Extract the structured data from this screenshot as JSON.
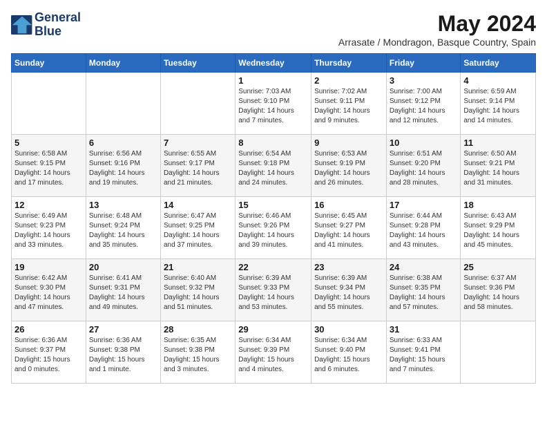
{
  "logo": {
    "line1": "General",
    "line2": "Blue"
  },
  "title": "May 2024",
  "subtitle": "Arrasate / Mondragon, Basque Country, Spain",
  "days_of_week": [
    "Sunday",
    "Monday",
    "Tuesday",
    "Wednesday",
    "Thursday",
    "Friday",
    "Saturday"
  ],
  "weeks": [
    [
      {
        "day": "",
        "info": ""
      },
      {
        "day": "",
        "info": ""
      },
      {
        "day": "",
        "info": ""
      },
      {
        "day": "1",
        "info": "Sunrise: 7:03 AM\nSunset: 9:10 PM\nDaylight: 14 hours\nand 7 minutes."
      },
      {
        "day": "2",
        "info": "Sunrise: 7:02 AM\nSunset: 9:11 PM\nDaylight: 14 hours\nand 9 minutes."
      },
      {
        "day": "3",
        "info": "Sunrise: 7:00 AM\nSunset: 9:12 PM\nDaylight: 14 hours\nand 12 minutes."
      },
      {
        "day": "4",
        "info": "Sunrise: 6:59 AM\nSunset: 9:14 PM\nDaylight: 14 hours\nand 14 minutes."
      }
    ],
    [
      {
        "day": "5",
        "info": "Sunrise: 6:58 AM\nSunset: 9:15 PM\nDaylight: 14 hours\nand 17 minutes."
      },
      {
        "day": "6",
        "info": "Sunrise: 6:56 AM\nSunset: 9:16 PM\nDaylight: 14 hours\nand 19 minutes."
      },
      {
        "day": "7",
        "info": "Sunrise: 6:55 AM\nSunset: 9:17 PM\nDaylight: 14 hours\nand 21 minutes."
      },
      {
        "day": "8",
        "info": "Sunrise: 6:54 AM\nSunset: 9:18 PM\nDaylight: 14 hours\nand 24 minutes."
      },
      {
        "day": "9",
        "info": "Sunrise: 6:53 AM\nSunset: 9:19 PM\nDaylight: 14 hours\nand 26 minutes."
      },
      {
        "day": "10",
        "info": "Sunrise: 6:51 AM\nSunset: 9:20 PM\nDaylight: 14 hours\nand 28 minutes."
      },
      {
        "day": "11",
        "info": "Sunrise: 6:50 AM\nSunset: 9:21 PM\nDaylight: 14 hours\nand 31 minutes."
      }
    ],
    [
      {
        "day": "12",
        "info": "Sunrise: 6:49 AM\nSunset: 9:23 PM\nDaylight: 14 hours\nand 33 minutes."
      },
      {
        "day": "13",
        "info": "Sunrise: 6:48 AM\nSunset: 9:24 PM\nDaylight: 14 hours\nand 35 minutes."
      },
      {
        "day": "14",
        "info": "Sunrise: 6:47 AM\nSunset: 9:25 PM\nDaylight: 14 hours\nand 37 minutes."
      },
      {
        "day": "15",
        "info": "Sunrise: 6:46 AM\nSunset: 9:26 PM\nDaylight: 14 hours\nand 39 minutes."
      },
      {
        "day": "16",
        "info": "Sunrise: 6:45 AM\nSunset: 9:27 PM\nDaylight: 14 hours\nand 41 minutes."
      },
      {
        "day": "17",
        "info": "Sunrise: 6:44 AM\nSunset: 9:28 PM\nDaylight: 14 hours\nand 43 minutes."
      },
      {
        "day": "18",
        "info": "Sunrise: 6:43 AM\nSunset: 9:29 PM\nDaylight: 14 hours\nand 45 minutes."
      }
    ],
    [
      {
        "day": "19",
        "info": "Sunrise: 6:42 AM\nSunset: 9:30 PM\nDaylight: 14 hours\nand 47 minutes."
      },
      {
        "day": "20",
        "info": "Sunrise: 6:41 AM\nSunset: 9:31 PM\nDaylight: 14 hours\nand 49 minutes."
      },
      {
        "day": "21",
        "info": "Sunrise: 6:40 AM\nSunset: 9:32 PM\nDaylight: 14 hours\nand 51 minutes."
      },
      {
        "day": "22",
        "info": "Sunrise: 6:39 AM\nSunset: 9:33 PM\nDaylight: 14 hours\nand 53 minutes."
      },
      {
        "day": "23",
        "info": "Sunrise: 6:39 AM\nSunset: 9:34 PM\nDaylight: 14 hours\nand 55 minutes."
      },
      {
        "day": "24",
        "info": "Sunrise: 6:38 AM\nSunset: 9:35 PM\nDaylight: 14 hours\nand 57 minutes."
      },
      {
        "day": "25",
        "info": "Sunrise: 6:37 AM\nSunset: 9:36 PM\nDaylight: 14 hours\nand 58 minutes."
      }
    ],
    [
      {
        "day": "26",
        "info": "Sunrise: 6:36 AM\nSunset: 9:37 PM\nDaylight: 15 hours\nand 0 minutes."
      },
      {
        "day": "27",
        "info": "Sunrise: 6:36 AM\nSunset: 9:38 PM\nDaylight: 15 hours\nand 1 minute."
      },
      {
        "day": "28",
        "info": "Sunrise: 6:35 AM\nSunset: 9:38 PM\nDaylight: 15 hours\nand 3 minutes."
      },
      {
        "day": "29",
        "info": "Sunrise: 6:34 AM\nSunset: 9:39 PM\nDaylight: 15 hours\nand 4 minutes."
      },
      {
        "day": "30",
        "info": "Sunrise: 6:34 AM\nSunset: 9:40 PM\nDaylight: 15 hours\nand 6 minutes."
      },
      {
        "day": "31",
        "info": "Sunrise: 6:33 AM\nSunset: 9:41 PM\nDaylight: 15 hours\nand 7 minutes."
      },
      {
        "day": "",
        "info": ""
      }
    ]
  ]
}
